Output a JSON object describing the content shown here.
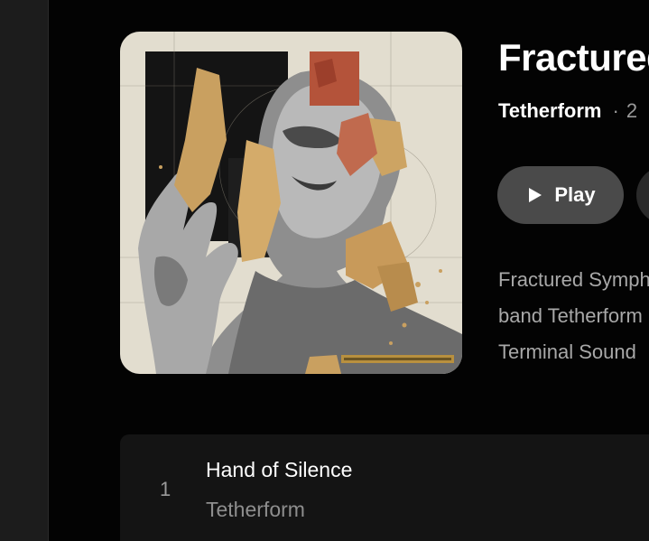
{
  "album": {
    "title": "Fractured Symphony",
    "artist": "Tetherform",
    "separator": "·",
    "year_partial": "2",
    "cover_icon": "album-cover-art"
  },
  "actions": {
    "play_label": "Play",
    "play_icon": "play-icon"
  },
  "description": {
    "line1": "Fractured Symphony",
    "line2": "band Tetherform",
    "line3": "Terminal Sound"
  },
  "tracks": [
    {
      "number": "1",
      "title": "Hand of Silence",
      "artist": "Tetherform"
    }
  ],
  "colors": {
    "background": "#030303",
    "sidebar": "#1c1c1c",
    "play_button": "#4a4a4a",
    "track_list": "#141414",
    "muted_text": "#a8a8a8",
    "gold": "#c9a060",
    "rust": "#b4533a"
  }
}
